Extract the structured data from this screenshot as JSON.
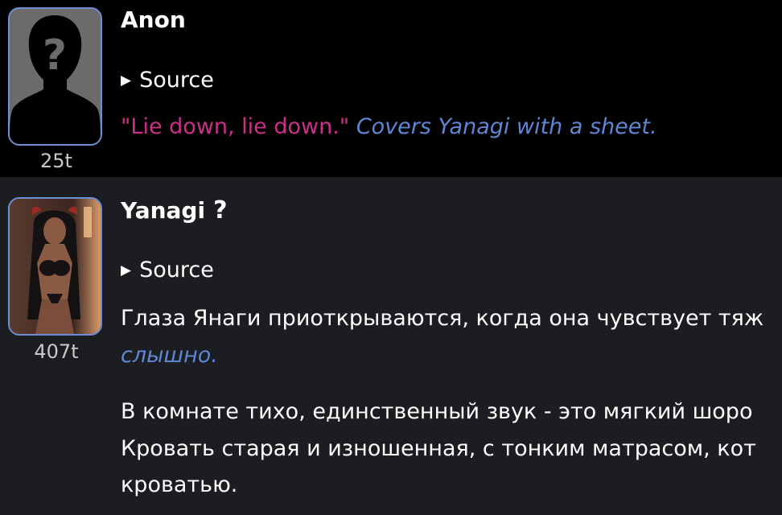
{
  "messages": [
    {
      "name": "Anon",
      "tokens": "25t",
      "source_label": "Source",
      "speech": "\"Lie down, lie down.\"",
      "action": "Covers Yanagi with a sheet."
    },
    {
      "name": "Yanagi",
      "help_symbol": "?",
      "tokens": "407t",
      "source_label": "Source",
      "paragraphs": [
        "Глаза Янаги приоткрываются, когда она чувствует тяж",
        "слышно.",
        "В комнате тихо, единственный звук - это мягкий шоро",
        "Кровать старая и изношенная, с тонким матрасом, кот",
        "кроватью."
      ]
    }
  ],
  "colors": {
    "user_bg": "#000000",
    "char_bg": "#1c1d21",
    "speech": "#cc2f88",
    "action": "#5f86d4",
    "avatar_border": "#6d8fd6"
  },
  "icons": {
    "user_avatar": "person-silhouette-question-icon",
    "char_avatar": "character-portrait",
    "expand": "triangle-right-icon",
    "help": "question-mark-icon"
  }
}
